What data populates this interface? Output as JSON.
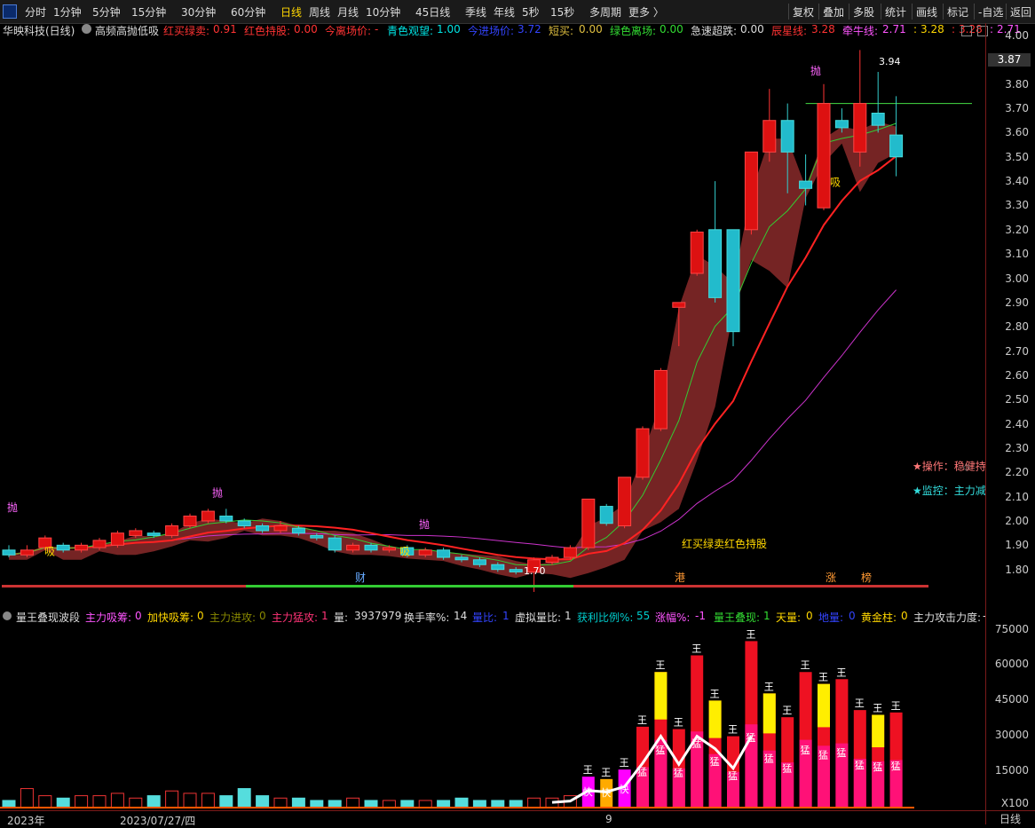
{
  "toolbar": {
    "periods": [
      "分时",
      "1分钟",
      "5分钟",
      "15分钟",
      "30分钟",
      "60分钟",
      "日线",
      "周线",
      "月线",
      "10分钟",
      "45日线",
      "季线",
      "年线",
      "5秒",
      "15秒",
      "多周期",
      "更多 〉"
    ],
    "active_period": "日线",
    "right_buttons": [
      "复权",
      "叠加",
      "多股",
      "统计",
      "画线",
      "标记",
      "-自选",
      "返回"
    ]
  },
  "info": {
    "stock": "华映科技(日线)",
    "indicator": "高频高抛低吸",
    "items": [
      {
        "label": "红买绿卖:",
        "value": "0.91",
        "color": "#ff3333"
      },
      {
        "label": "红色持股:",
        "value": "0.00",
        "color": "#ff3333"
      },
      {
        "label": "今离场价:",
        "value": "-",
        "color": "#ff3333"
      },
      {
        "label": "青色观望:",
        "value": "1.00",
        "color": "#00e5e5"
      },
      {
        "label": "今进场价:",
        "value": "3.72",
        "color": "#3344ff"
      },
      {
        "label": "短买:",
        "value": "0.00",
        "color": "#e0c040"
      },
      {
        "label": "绿色离场:",
        "value": "0.00",
        "color": "#33dd33"
      },
      {
        "label": "急速超跌:",
        "value": "0.00",
        "color": "#dddddd"
      },
      {
        "label": "辰星线:",
        "value": "3.28",
        "color": "#ff3333"
      },
      {
        "label": "牵牛线:",
        "value": "2.71",
        "color": "#ff55ff"
      },
      {
        "label": ":",
        "value": "3.28",
        "color": "#ffd700"
      },
      {
        "label": ":",
        "value": "3.28",
        "color": "#ff3333"
      },
      {
        "label": ":",
        "value": "2.71",
        "color": "#ff55ff"
      }
    ]
  },
  "price_axis": {
    "ticks": [
      "4.00",
      "3.90",
      "3.80",
      "3.70",
      "3.60",
      "3.50",
      "3.40",
      "3.30",
      "3.20",
      "3.10",
      "3.00",
      "2.90",
      "2.80",
      "2.70",
      "2.60",
      "2.50",
      "2.40",
      "2.30",
      "2.20",
      "2.10",
      "2.00",
      "1.90",
      "1.80"
    ],
    "current": "3.87",
    "high_label": "3.94",
    "low_label": "1.70"
  },
  "chart_labels": {
    "pao": "抛",
    "xi": "吸",
    "wang": "王",
    "tian": "天",
    "meng": "猛",
    "kuai": "快",
    "jin": "进",
    "bao": "暴",
    "signal": "红买绿卖红色持股",
    "operation": "★操作：稳健持股",
    "monitor": "★监控：主力减仓",
    "events": [
      "财",
      "港",
      "涨",
      "榜"
    ]
  },
  "vol_info": {
    "name": "量王叠现波段",
    "items": [
      {
        "label": "主力吸筹:",
        "value": "0",
        "color": "#ff55ff"
      },
      {
        "label": "加快吸筹:",
        "value": "0",
        "color": "#ffd700"
      },
      {
        "label": "主力进攻:",
        "value": "0",
        "color": "#888800"
      },
      {
        "label": "主力猛攻:",
        "value": "1",
        "color": "#ff3377"
      },
      {
        "label": "量:",
        "value": "3937979",
        "color": "#dddddd"
      },
      {
        "label": "换手率%:",
        "value": "14",
        "color": "#dddddd"
      },
      {
        "label": "量比:",
        "value": "1",
        "color": "#3344ff"
      },
      {
        "label": "虚拟量比:",
        "value": "1",
        "color": "#dddddd"
      },
      {
        "label": "获利比例%:",
        "value": "55",
        "color": "#00cccc"
      },
      {
        "label": "涨幅%:",
        "value": "-1",
        "color": "#ff55ff"
      },
      {
        "label": "量王叠现:",
        "value": "1",
        "color": "#33dd33"
      },
      {
        "label": "天量:",
        "value": "0",
        "color": "#ffd700"
      },
      {
        "label": "地量:",
        "value": "0",
        "color": "#3344ff"
      },
      {
        "label": "黄金柱:",
        "value": "0",
        "color": "#ffd700"
      },
      {
        "label": "主力攻击力度:",
        "value": "-",
        "color": "#dddddd"
      }
    ]
  },
  "vol_axis": {
    "ticks": [
      "75000",
      "60000",
      "45000",
      "30000",
      "15000"
    ],
    "unit": "X100"
  },
  "bottom_axis": {
    "year": "2023年",
    "date": "2023/07/27/四",
    "month": "9",
    "period_label": "日线"
  },
  "chart_data": {
    "type": "candlestick",
    "ylim": [
      1.75,
      4.0
    ],
    "candles": [
      [
        1.88,
        1.86,
        1.9,
        1.85
      ],
      [
        1.86,
        1.88,
        1.9,
        1.85
      ],
      [
        1.89,
        1.93,
        1.94,
        1.88
      ],
      [
        1.9,
        1.88,
        1.91,
        1.87
      ],
      [
        1.88,
        1.9,
        1.91,
        1.87
      ],
      [
        1.89,
        1.92,
        1.93,
        1.88
      ],
      [
        1.9,
        1.95,
        1.96,
        1.89
      ],
      [
        1.94,
        1.96,
        1.97,
        1.93
      ],
      [
        1.95,
        1.94,
        1.96,
        1.93
      ],
      [
        1.94,
        1.98,
        1.99,
        1.93
      ],
      [
        1.98,
        2.02,
        2.03,
        1.97
      ],
      [
        2.0,
        2.04,
        2.05,
        1.99
      ],
      [
        2.02,
        2.0,
        2.05,
        1.99
      ],
      [
        2.0,
        1.98,
        2.01,
        1.97
      ],
      [
        1.98,
        1.96,
        1.99,
        1.95
      ],
      [
        1.96,
        1.98,
        2.0,
        1.95
      ],
      [
        1.97,
        1.95,
        1.98,
        1.94
      ],
      [
        1.94,
        1.93,
        1.95,
        1.92
      ],
      [
        1.93,
        1.88,
        1.94,
        1.87
      ],
      [
        1.88,
        1.9,
        1.91,
        1.87
      ],
      [
        1.9,
        1.88,
        1.91,
        1.87
      ],
      [
        1.88,
        1.89,
        1.9,
        1.87
      ],
      [
        1.89,
        1.86,
        1.9,
        1.85
      ],
      [
        1.86,
        1.88,
        1.89,
        1.85
      ],
      [
        1.88,
        1.85,
        1.89,
        1.84
      ],
      [
        1.85,
        1.84,
        1.86,
        1.83
      ],
      [
        1.84,
        1.82,
        1.85,
        1.81
      ],
      [
        1.82,
        1.8,
        1.83,
        1.79
      ],
      [
        1.8,
        1.79,
        1.81,
        1.78
      ],
      [
        1.79,
        1.84,
        1.85,
        1.7
      ],
      [
        1.83,
        1.85,
        1.86,
        1.82
      ],
      [
        1.85,
        1.89,
        1.9,
        1.84
      ],
      [
        1.89,
        2.09,
        2.09,
        1.88
      ],
      [
        2.06,
        1.99,
        2.07,
        1.98
      ],
      [
        1.98,
        2.18,
        2.18,
        1.97
      ],
      [
        2.18,
        2.38,
        2.39,
        2.17
      ],
      [
        2.38,
        2.62,
        2.63,
        2.37
      ],
      [
        2.88,
        2.9,
        2.9,
        2.72
      ],
      [
        3.02,
        3.19,
        3.2,
        3.01
      ],
      [
        3.2,
        2.92,
        3.4,
        2.9
      ],
      [
        3.2,
        2.78,
        3.2,
        2.72
      ],
      [
        3.2,
        3.52,
        3.52,
        3.18
      ],
      [
        3.52,
        3.65,
        3.78,
        3.48
      ],
      [
        3.65,
        3.52,
        3.72,
        3.35
      ],
      [
        3.4,
        3.37,
        3.51,
        3.3
      ],
      [
        3.29,
        3.72,
        3.8,
        3.28
      ],
      [
        3.65,
        3.62,
        3.7,
        3.6
      ],
      [
        3.52,
        3.72,
        3.94,
        3.46
      ],
      [
        3.68,
        3.63,
        3.85,
        3.6
      ],
      [
        3.59,
        3.5,
        3.75,
        3.42
      ]
    ],
    "volumes": [
      3,
      8,
      5,
      4,
      5,
      5,
      6,
      4,
      5,
      7,
      6,
      6,
      5,
      8,
      5,
      4,
      4,
      3,
      3,
      4,
      3,
      3,
      3,
      3,
      3,
      4,
      3,
      3,
      3,
      4,
      4,
      5,
      13,
      12,
      16,
      34,
      57,
      33,
      64,
      45,
      30,
      70,
      48,
      38,
      57,
      52,
      54,
      41,
      39,
      40
    ]
  }
}
